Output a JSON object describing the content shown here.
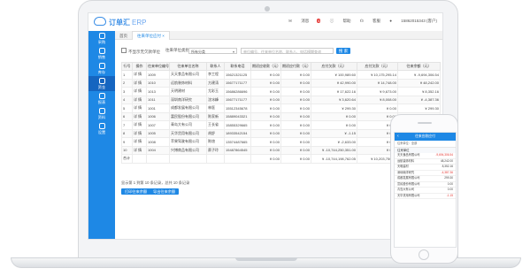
{
  "app": {
    "brand": "订单汇",
    "product": "ERP",
    "messages_label": "消息",
    "messages_count": "6",
    "help_label": "帮助",
    "service_label": "客服",
    "user_label": "15862015343 (客户)"
  },
  "sidebar": {
    "items": [
      {
        "label": "采购",
        "icon": "cart-icon"
      },
      {
        "label": "销售",
        "icon": "sale-icon"
      },
      {
        "label": "库存",
        "icon": "box-icon"
      },
      {
        "label": "资金",
        "icon": "money-icon"
      },
      {
        "label": "报表",
        "icon": "chart-icon"
      },
      {
        "label": "资料",
        "icon": "doc-icon"
      },
      {
        "label": "设置",
        "icon": "gear-icon"
      }
    ]
  },
  "tabs": [
    {
      "label": "首页"
    },
    {
      "label": "往来单位应付 ×"
    }
  ],
  "filters": {
    "show_zero_label": "不显示无欠款单位",
    "category_label": "往来单位类别",
    "category_value": "所有分类",
    "search_placeholder": "单位编号、往来单位名称、联系人、电话模糊查询",
    "search_button": "搜 索"
  },
  "table": {
    "columns": [
      "行号",
      "操作",
      "往来单位编号",
      "往来单位名称",
      "联系人",
      "联系电话",
      "期初应收款（元）",
      "期初应付款（元）",
      "应付欠款（元）",
      "应付欠款（元）",
      "往来余额（元）"
    ],
    "rows": [
      [
        "1",
        "详 情",
        "1009",
        "天天食品有限公司",
        "李工程",
        "15621321125",
        "¥ 0.00",
        "¥ 0.00",
        "¥ 100,989.60",
        "¥ 10,175,295.14",
        "¥ -9,694,306.54"
      ],
      [
        "2",
        "详 情",
        "1010",
        "远航装饰材料",
        "方建涛",
        "15677171177",
        "¥ 0.00",
        "¥ 0.00",
        "¥ 42,990.00",
        "¥ 14,748.00",
        "¥ 48,242.00"
      ],
      [
        "3",
        "详 情",
        "1013",
        "天明建材",
        "尤彩玉",
        "15686286696",
        "¥ 0.00",
        "¥ 0.00",
        "¥ 17,622.16",
        "¥ 9,673.00",
        "¥ 8,352.16"
      ],
      [
        "4",
        "详 情",
        "1011",
        "深圳南洋研究",
        "沈冰峰",
        "15677171177",
        "¥ 0.00",
        "¥ 0.00",
        "¥ 3,620.64",
        "¥ 8,008.00",
        "¥ -4,387.36"
      ],
      [
        "5",
        "详 情",
        "1001",
        "成都发展有限公司",
        "林医",
        "15512345678",
        "¥ 0.00",
        "¥ 0.00",
        "¥ 299.30",
        "¥ 0.00",
        "¥ 299.30"
      ],
      [
        "6",
        "详 情",
        "1006",
        "富民股份有限公司",
        "陈家新",
        "15889043321",
        "¥ 0.00",
        "¥ 0.00",
        "¥ 0.00",
        "¥ 0.00",
        "¥ 0.00"
      ],
      [
        "7",
        "详 情",
        "1007",
        "青岛大有公司",
        "王长省",
        "15855329665",
        "¥ 0.00",
        "¥ 0.00",
        "¥ 0.00",
        "¥ 0.00",
        "¥ 0.00"
      ],
      [
        "8",
        "详 情",
        "1005",
        "天华货用有限公司",
        "胡舒",
        "18933542154",
        "¥ 0.00",
        "¥ 0.00",
        "¥ -1.15",
        "¥ 0.00",
        "¥ -1.15"
      ],
      [
        "9",
        "详 情",
        "1008",
        "苹果驾驶有限公司",
        "陈煊",
        "13574487665",
        "¥ 0.00",
        "¥ 0.00",
        "¥ -2,633.00",
        "¥ 0.00",
        "¥ -2,633.00"
      ],
      [
        "10",
        "详 情",
        "1004",
        "兴博商品有限公司",
        "蔡子玲",
        "15487864545",
        "¥ 0.00",
        "¥ 0.00",
        "¥ -10,744,250,351.00",
        "¥ 0.00",
        "¥ -10,744,250,351.00"
      ]
    ],
    "total": [
      "合计",
      "",
      "",
      "",
      "",
      "",
      "¥ 0.00",
      "¥ 0.00",
      "¥ -10,744,198,762.05",
      "¥ 10,203,750.54",
      "¥ -10,754,387,112.59"
    ]
  },
  "pager": {
    "text": "显示第 1 到第 10 条记录，总共 10 条记录"
  },
  "actions": {
    "print_label": "打印往来余额",
    "export_label": "导出往来余额"
  },
  "phone": {
    "title": "往来应收应付",
    "filter_label": "往来单位：全部",
    "section_title": "往来单位",
    "rows": [
      {
        "name": "天天食品有限公司",
        "value": "-9,694,306.54"
      },
      {
        "name": "远航装饰材料",
        "value": "48,242.00"
      },
      {
        "name": "天明建材",
        "value": "8,352.16"
      },
      {
        "name": "深圳南洋研究",
        "value": "-4,387.36"
      },
      {
        "name": "成都发展有限公司",
        "value": "299.30"
      },
      {
        "name": "富民股份有限公司",
        "value": "0.00"
      },
      {
        "name": "青岛大有公司",
        "value": "0.00"
      },
      {
        "name": "天华货用有限公司",
        "value": "-1.15"
      }
    ]
  },
  "colors": {
    "accent": "#1e88e5",
    "sidebar": "#1e88e5",
    "negative": "#e53935"
  }
}
